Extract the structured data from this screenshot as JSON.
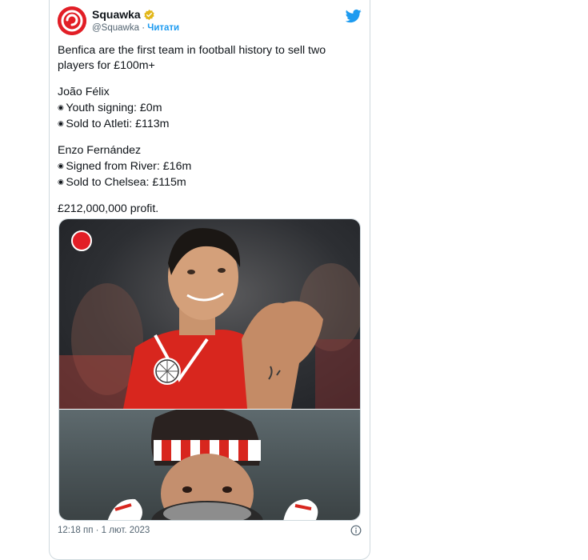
{
  "account": {
    "name": "Squawka",
    "handle": "@Squawka",
    "separator": "·",
    "follow_label": "Читати"
  },
  "tweet": {
    "headline": "Benfica are the first team in football history to sell two players for £100m+",
    "player1": {
      "name": "João Félix",
      "line1": "Youth signing: £0m",
      "line2": "Sold to Atleti: £113m"
    },
    "player2": {
      "name": "Enzo Fernández",
      "line1": "Signed from River: £16m",
      "line2": "Sold to Chelsea: £115m"
    },
    "profit": "£212,000,000 profit."
  },
  "footer": {
    "timestamp": "12:18 пп · 1 лют. 2023"
  },
  "icons": {
    "avatar": "squawka-logo-icon",
    "verified": "verified-badge-icon",
    "platform": "twitter-bird-icon",
    "info": "info-icon"
  },
  "colors": {
    "brand_red": "#e21e26",
    "twitter_blue": "#1d9bf0",
    "verified_gold": "#e2b719",
    "muted_text": "#536471"
  }
}
